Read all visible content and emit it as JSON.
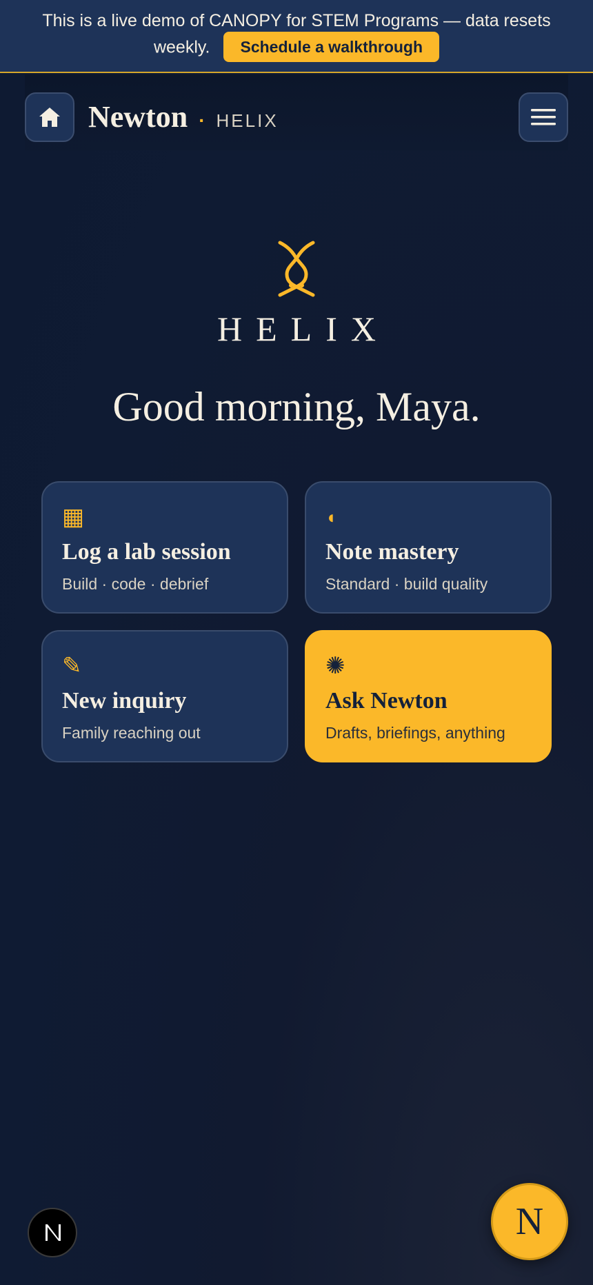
{
  "banner": {
    "text": "This is a live demo of CANOPY for STEM Programs — data resets weekly.",
    "cta_label": "Schedule a walkthrough"
  },
  "header": {
    "home_icon": "home-icon",
    "brand_name": "Newton",
    "separator": "·",
    "brand_sub": "HELIX",
    "menu_icon": "hamburger-menu-icon"
  },
  "hero": {
    "logo_icon": "helix-logo-icon",
    "wordmark": "HELIX",
    "greeting": "Good morning, Maya."
  },
  "cards": [
    {
      "icon_name": "grid-icon",
      "icon_glyph": "▦",
      "title": "Log a lab session",
      "subtitle": "Build · code · debrief"
    },
    {
      "icon_name": "half-moon-icon",
      "icon_glyph": "◖",
      "title": "Note mastery",
      "subtitle": "Standard · build quality"
    },
    {
      "icon_name": "pencil-icon",
      "icon_glyph": "✎",
      "title": "New inquiry",
      "subtitle": "Family reaching out"
    },
    {
      "icon_name": "sparkle-icon",
      "icon_glyph": "✺",
      "title": "Ask Newton",
      "subtitle": "Drafts, briefings, anything"
    }
  ],
  "fab": {
    "small_icon": "n-logo-icon",
    "small_label": "N",
    "big_label": "N"
  },
  "colors": {
    "background": "#0f1b33",
    "surface": "#1e3358",
    "accent": "#fbb829",
    "text": "#f5efe2"
  }
}
